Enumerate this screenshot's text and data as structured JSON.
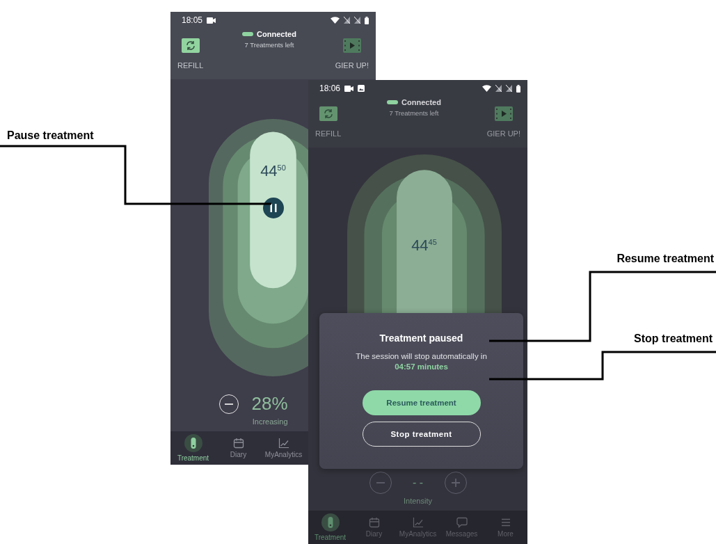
{
  "annotations": [
    {
      "label": "Pause treatment"
    },
    {
      "label": "Resume treatment"
    },
    {
      "label": "Stop treatment"
    }
  ],
  "screens": [
    {
      "status_time": "18:05",
      "status_icons": [
        {
          "kind": "video"
        }
      ],
      "connection": {
        "label": "Connected",
        "detail": "7 Treatments left"
      },
      "actions": [
        {
          "kind": "refill",
          "label": "REFILL"
        },
        {
          "kind": "film",
          "label": "GIER UP!"
        }
      ],
      "timer": {
        "minutes": "44",
        "seconds": "50",
        "running": true
      },
      "intensity": {
        "value": "28%",
        "caption": "Increasing",
        "controls": [
          {
            "kind": "minus"
          }
        ]
      },
      "nav": [
        {
          "kind": "treatment",
          "label": "Treatment",
          "selected": true
        },
        {
          "kind": "diary",
          "label": "Diary",
          "selected": false
        },
        {
          "kind": "analytics",
          "label": "MyAnalytics",
          "selected": false
        }
      ]
    },
    {
      "status_time": "18:06",
      "status_icons": [
        {
          "kind": "video"
        },
        {
          "kind": "image"
        }
      ],
      "connection": {
        "label": "Connected",
        "detail": "7 Treatments left"
      },
      "actions": [
        {
          "kind": "refill",
          "label": "REFILL"
        },
        {
          "kind": "film",
          "label": "GIER UP!"
        }
      ],
      "timer": {
        "minutes": "44",
        "seconds": "45",
        "running": false
      },
      "dialog": {
        "title": "Treatment paused",
        "message": "The session will stop automatically in",
        "countdown": "04:57 minutes",
        "buttons": [
          {
            "kind": "primary",
            "label": "Resume treatment"
          },
          {
            "kind": "secondary",
            "label": "Stop treatment"
          }
        ]
      },
      "intensity": {
        "value": "- -",
        "caption": "Intensity",
        "controls": [
          {
            "kind": "minus"
          },
          {
            "kind": "plus"
          }
        ]
      },
      "nav": [
        {
          "kind": "treatment",
          "label": "Treatment",
          "selected": true
        },
        {
          "kind": "diary",
          "label": "Diary",
          "selected": false
        },
        {
          "kind": "analytics",
          "label": "MyAnalytics",
          "selected": false
        },
        {
          "kind": "messages",
          "label": "Messages",
          "selected": false
        },
        {
          "kind": "more",
          "label": "More",
          "selected": false
        }
      ]
    }
  ]
}
